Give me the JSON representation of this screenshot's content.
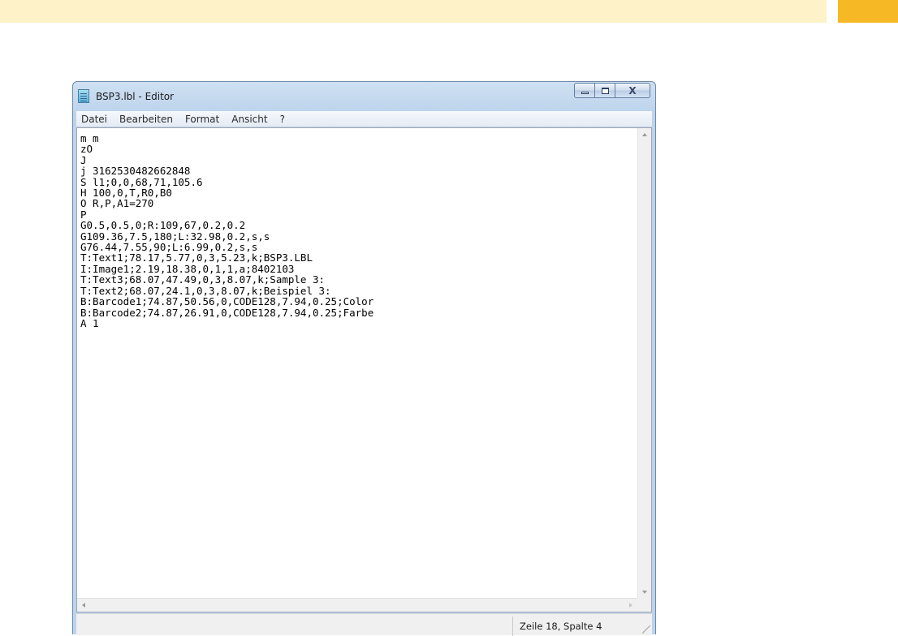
{
  "window": {
    "title": "BSP3.lbl - Editor",
    "close_glyph": "X",
    "icons": [
      "notepad-icon",
      "minimize-icon",
      "maximize-icon",
      "close-icon"
    ]
  },
  "menu": [
    "Datei",
    "Bearbeiten",
    "Format",
    "Ansicht",
    "?"
  ],
  "editor": {
    "content": "m m\nzO\nJ\nj 3162530482662848\nS l1;0,0,68,71,105.6\nH 100,0,T,R0,B0\nO R,P,A1=270\nP\nG0.5,0.5,0;R:109,67,0.2,0.2\nG109.36,7.5,180;L:32.98,0.2,s,s\nG76.44,7.55,90;L:6.99,0.2,s,s\nT:Text1;78.17,5.77,0,3,5.23,k;BSP3.LBL\nI:Image1;2.19,18.38,0,1,1,a;8402103\nT:Text3;68.07,47.49,0,3,8.07,k;Sample 3:\nT:Text2;68.07,24.1,0,3,8.07,k;Beispiel 3:\nB:Barcode1;74.87,50.56,0,CODE128,7.94,0.25;Color\nB:Barcode2;74.87,26.91,0,CODE128,7.94,0.25;Farbe\nA 1"
  },
  "status": {
    "position": "Zeile 18, Spalte 4"
  },
  "colors": {
    "banner": "#fdf2c8",
    "banner_accent": "#f7b825",
    "window_frame": "#bcd3ec"
  }
}
